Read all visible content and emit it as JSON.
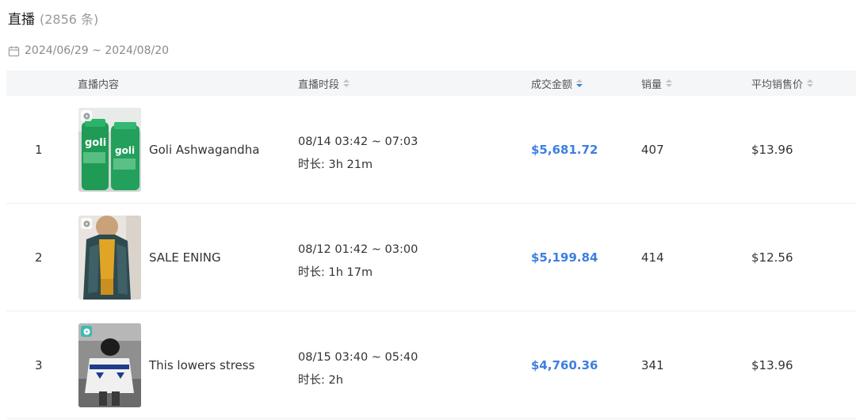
{
  "header": {
    "title": "直播",
    "count": "(2856 条)"
  },
  "date_range": {
    "icon": "calendar-icon",
    "text": "2024/06/29 ~ 2024/08/20"
  },
  "colors": {
    "accent": "#3d7fe0",
    "header_bg": "#f5f6f8",
    "muted": "#9a9a9a"
  },
  "columns": {
    "content": "直播内容",
    "period": "直播时段",
    "gmv": "成交金额",
    "sales": "销量",
    "avg_price": "平均销售价"
  },
  "rows": [
    {
      "rank": "1",
      "name": "Goli Ashwagandha",
      "period": "08/14 03:42 ~ 07:03",
      "duration": "时长: 3h 21m",
      "gmv": "$5,681.72",
      "sales": "407",
      "avg_price": "$13.96",
      "thumb_icon": "green-supplement-bottles-thumbnail"
    },
    {
      "rank": "2",
      "name": "SALE ENING",
      "period": "08/12 01:42 ~ 03:00",
      "duration": "时长: 1h 17m",
      "gmv": "$5,199.84",
      "sales": "414",
      "avg_price": "$12.56",
      "thumb_icon": "clothing-model-thumbnail"
    },
    {
      "rank": "3",
      "name": "This lowers stress",
      "period": "08/15 03:40 ~ 05:40",
      "duration": "时长: 2h",
      "gmv": "$4,760.36",
      "sales": "341",
      "avg_price": "$13.96",
      "thumb_icon": "person-in-jersey-thumbnail"
    }
  ]
}
